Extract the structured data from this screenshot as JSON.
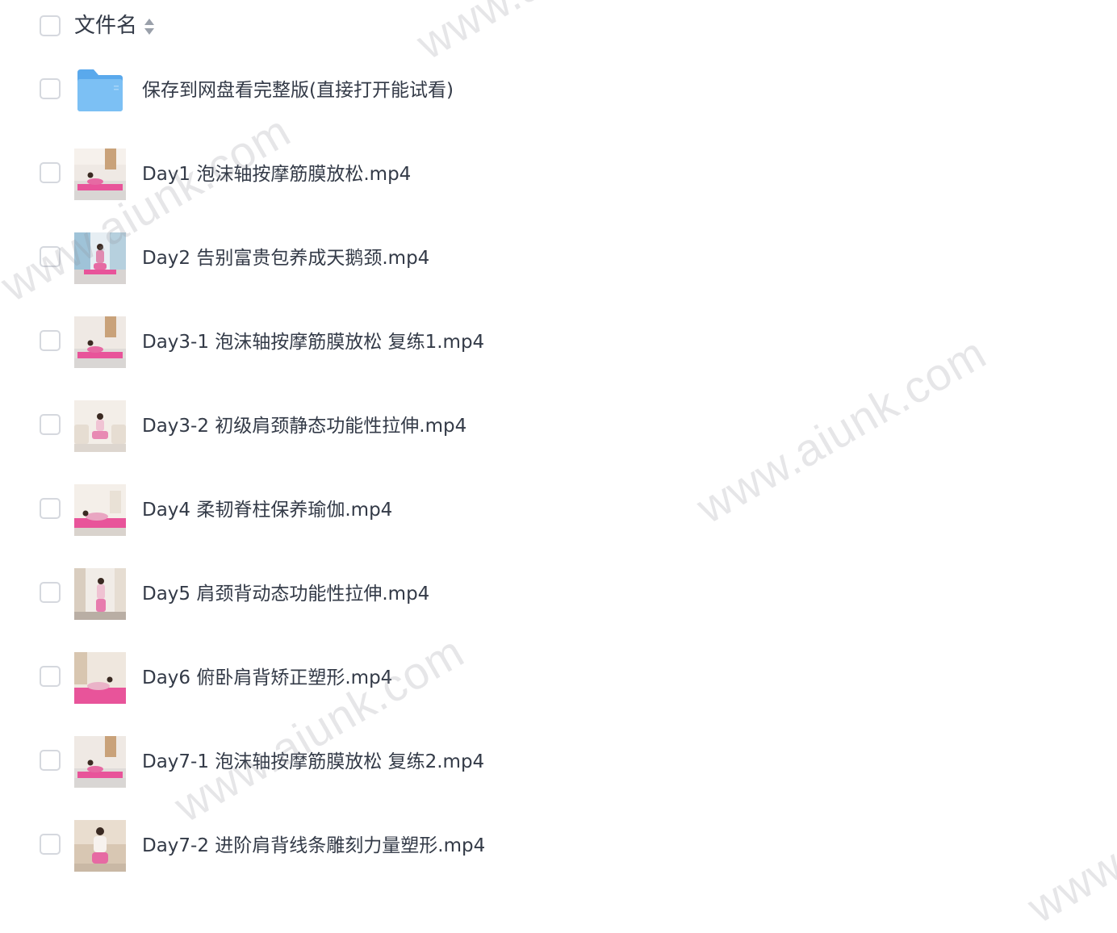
{
  "header": {
    "column_label": "文件名",
    "sort_icon": "sort-updown-icon"
  },
  "files": [
    {
      "name": "保存到网盘看完整版(直接打开能试看)",
      "type": "folder",
      "icon": "folder-icon"
    },
    {
      "name": "Day1 泡沫轴按摩筋膜放松.mp4",
      "type": "video",
      "icon": "video-thumbnail"
    },
    {
      "name": "Day2 告别富贵包养成天鹅颈.mp4",
      "type": "video",
      "icon": "video-thumbnail"
    },
    {
      "name": "Day3-1 泡沫轴按摩筋膜放松 复练1.mp4",
      "type": "video",
      "icon": "video-thumbnail"
    },
    {
      "name": "Day3-2 初级肩颈静态功能性拉伸.mp4",
      "type": "video",
      "icon": "video-thumbnail"
    },
    {
      "name": "Day4 柔韧脊柱保养瑜伽.mp4",
      "type": "video",
      "icon": "video-thumbnail"
    },
    {
      "name": "Day5 肩颈背动态功能性拉伸.mp4",
      "type": "video",
      "icon": "video-thumbnail"
    },
    {
      "name": "Day6 俯卧肩背矫正塑形.mp4",
      "type": "video",
      "icon": "video-thumbnail"
    },
    {
      "name": "Day7-1 泡沫轴按摩筋膜放松 复练2.mp4",
      "type": "video",
      "icon": "video-thumbnail"
    },
    {
      "name": "Day7-2 进阶肩背线条雕刻力量塑形.mp4",
      "type": "video",
      "icon": "video-thumbnail"
    }
  ],
  "watermarks": [
    "www.aiunk.com",
    "www.aiunk.com",
    "www.aiunk.com",
    "www.aiunk.com",
    "www.aiunk.com"
  ],
  "colors": {
    "text": "#333a47",
    "checkbox_border": "#d5d8de",
    "folder": "#6ab4f0",
    "mat_pink": "#e8549a"
  }
}
